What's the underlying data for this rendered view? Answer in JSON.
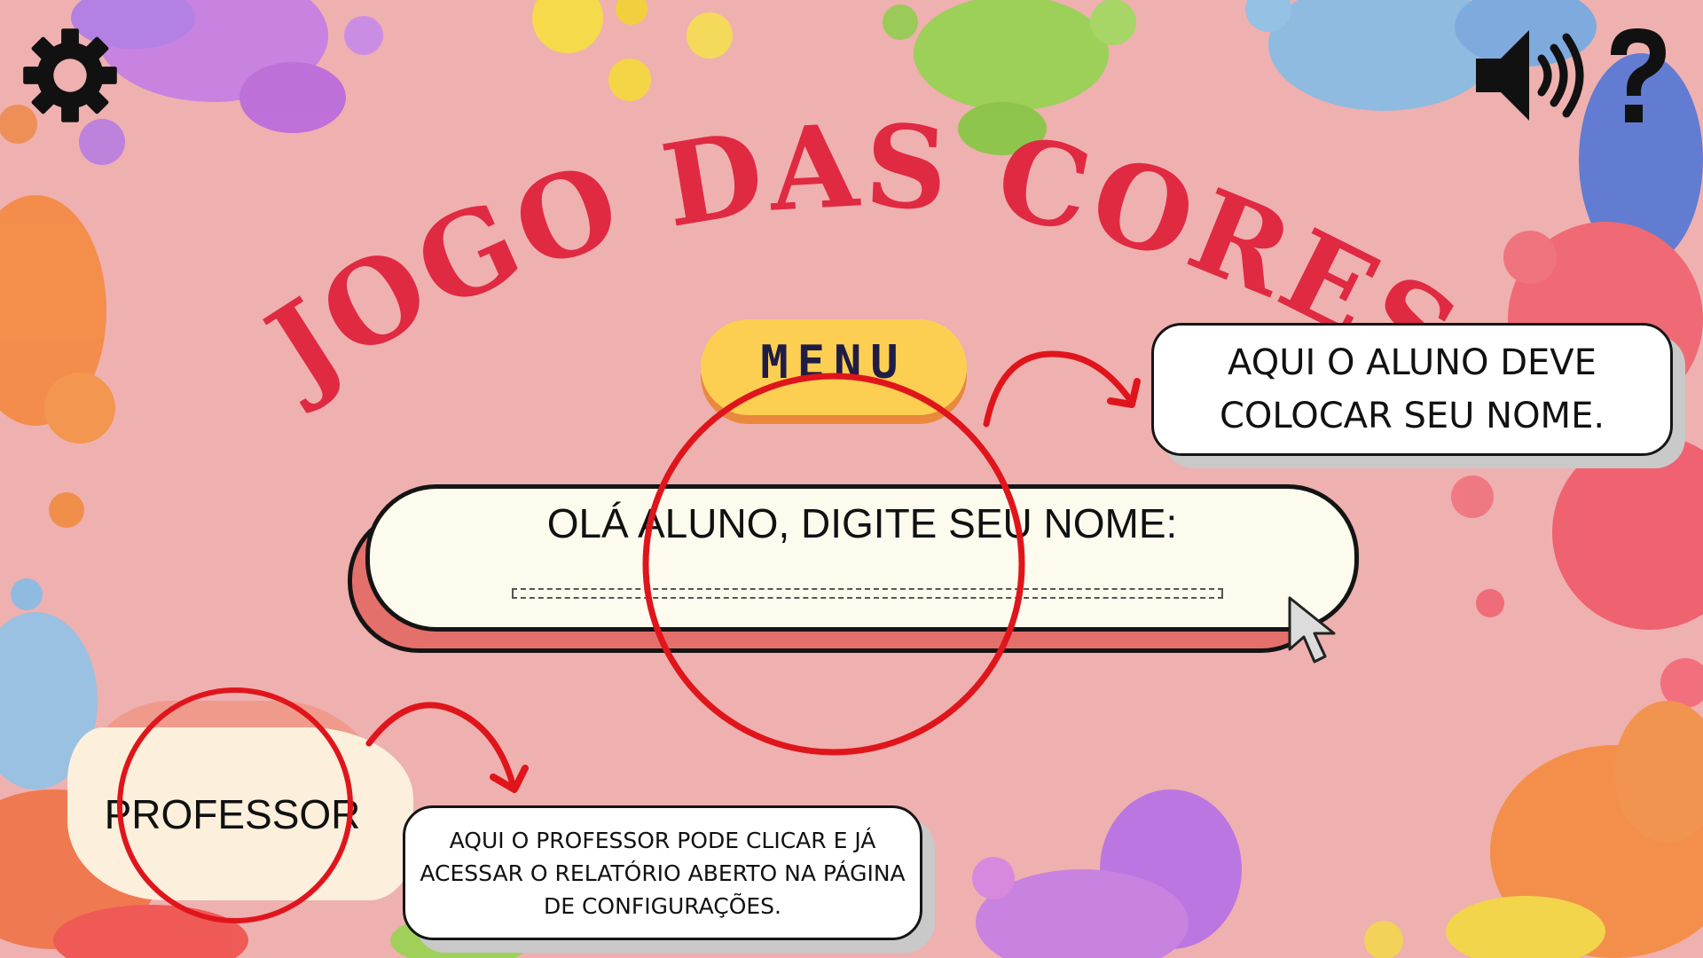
{
  "title": "JOGO DAS CORES",
  "menu_label": "MENU",
  "name_box": {
    "prompt": "OLÁ ALUNO, DIGITE SEU NOME:",
    "value": ""
  },
  "callouts": {
    "aluno": [
      "AQUI O ALUNO DEVE",
      "COLOCAR SEU NOME."
    ],
    "professor": [
      "AQUI O PROFESSOR PODE CLICAR E JÁ",
      "ACESSAR O RELATÓRIO ABERTO NA PÁGINA",
      "DE CONFIGURAÇÕES."
    ]
  },
  "professor_button": "PROFESSOR",
  "icons": {
    "settings": "gear-icon",
    "sound": "speaker-icon",
    "help": "question-mark-icon",
    "cursor": "mouse-pointer-icon"
  },
  "colors": {
    "background": "#efb0b0",
    "title": "#e02a42",
    "menu_pill": "#fccf52",
    "highlight_circle": "#e0151c",
    "arrow": "#e0151c"
  }
}
